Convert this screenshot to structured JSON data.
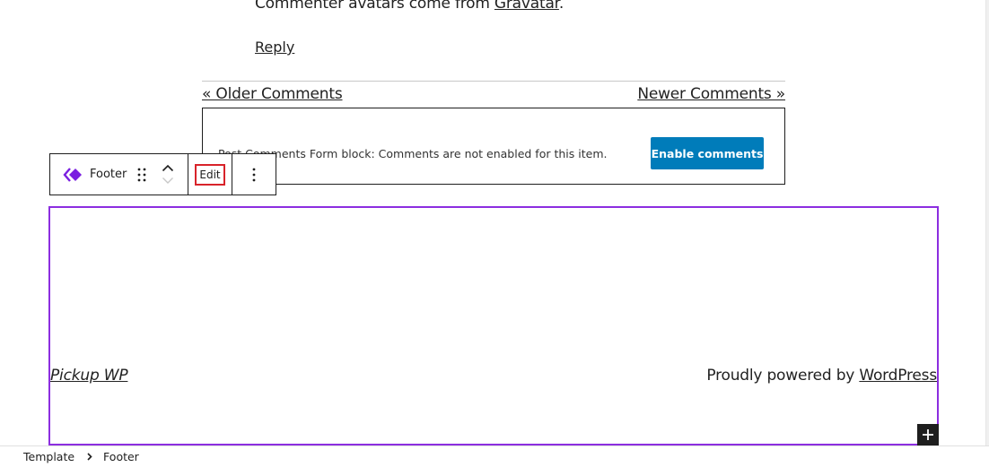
{
  "comment": {
    "avatars_text": "Commenter avatars come from ",
    "gravatar_link": "Gravatar",
    "avatars_suffix": ".",
    "reply_label": "Reply"
  },
  "pagination": {
    "older_label": "« Older Comments",
    "newer_label": "Newer Comments »"
  },
  "comments_form": {
    "message": "Post Comments Form block: Comments are not enabled for this item.",
    "enable_button": "Enable comments"
  },
  "block_toolbar": {
    "block_icon": "template-part-icon",
    "block_label": "Footer",
    "drag_icon": "drag-handle-icon",
    "move_up_icon": "chevron-up-icon",
    "move_down_icon": "chevron-down-icon",
    "edit_label": "Edit",
    "more_icon": "more-vertical-icon"
  },
  "footer": {
    "site_title": "Pickup WP",
    "powered_text": "Proudly powered by ",
    "powered_link": "WordPress",
    "add_block_icon": "plus-icon"
  },
  "breadcrumb": {
    "items": [
      "Template",
      "Footer"
    ],
    "separator_icon": "chevron-right-icon"
  },
  "colors": {
    "accent_purple": "#8c2ee0",
    "button_blue": "#007cba",
    "highlight_red": "#d8232a",
    "dark": "#1e1e1e"
  }
}
